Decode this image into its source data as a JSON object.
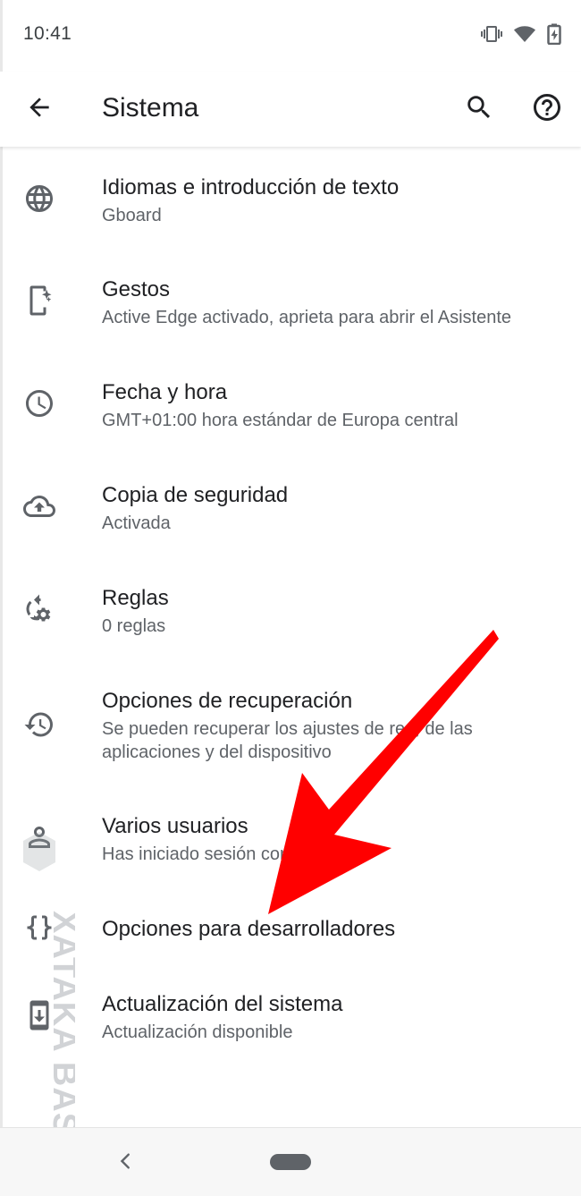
{
  "status_bar": {
    "time": "10:41",
    "icons": [
      "vibrate-icon",
      "wifi-icon",
      "battery-charging-icon"
    ]
  },
  "app_bar": {
    "title": "Sistema",
    "back_icon": "arrow-back-icon",
    "search_icon": "search-icon",
    "help_icon": "help-icon"
  },
  "items": [
    {
      "title": "Idiomas e introducción de texto",
      "subtitle": "Gboard",
      "icon": "globe-icon"
    },
    {
      "title": "Gestos",
      "subtitle": "Active Edge activado, aprieta para abrir el Asistente",
      "icon": "phone-gestures-icon"
    },
    {
      "title": "Fecha y hora",
      "subtitle": "GMT+01:00 hora estándar de Europa central",
      "icon": "clock-icon"
    },
    {
      "title": "Copia de seguridad",
      "subtitle": "Activada",
      "icon": "cloud-upload-icon"
    },
    {
      "title": "Reglas",
      "subtitle": "0 reglas",
      "icon": "rules-icon"
    },
    {
      "title": "Opciones de recuperación",
      "subtitle": "Se pueden recuperar los ajustes de red, de las aplicaciones y del dispositivo",
      "icon": "restore-icon"
    },
    {
      "title": "Varios usuarios",
      "subtitle": "Has iniciado sesión como Miguel",
      "icon": "person-icon"
    },
    {
      "title": "Opciones para desarrolladores",
      "subtitle": "",
      "icon": "code-braces-icon"
    },
    {
      "title": "Actualización del sistema",
      "subtitle": "Actualización disponible",
      "icon": "system-update-icon"
    }
  ],
  "nav_bar": {
    "back_icon": "nav-back-icon",
    "home_icon": "home-pill-icon"
  },
  "colors": {
    "text_primary": "#202124",
    "text_secondary": "#5f6368",
    "icon": "#5f6368",
    "annotation_arrow": "#ff0000"
  },
  "watermark": "XATAKA BASICS"
}
